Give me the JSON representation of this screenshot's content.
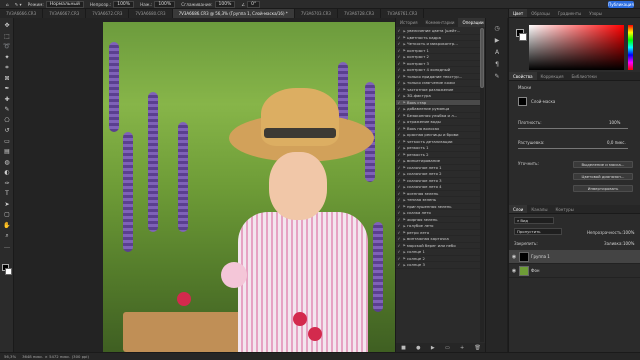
{
  "topbar": {
    "mode_label": "Режим:",
    "mode_value": "Нормальный",
    "opacity_label": "Непрозр.:",
    "opacity_value": "100%",
    "flow_label": "Наж.:",
    "flow_value": "100%",
    "smoothing_label": "Сглаживание:",
    "smoothing_value": "100%",
    "angle_value": "0°",
    "share_label": "Публикация"
  },
  "tabs": [
    {
      "label": "7V3A6666.CR3",
      "active": false
    },
    {
      "label": "7V3A6667.CR3",
      "active": false
    },
    {
      "label": "7V3A6672.CR3",
      "active": false
    },
    {
      "label": "7V3A6680.CR3",
      "active": false
    },
    {
      "label": "7V3A6686.CR3 @ 56,3% (Группа 1, Слой-маска/16) *",
      "active": true
    },
    {
      "label": "7V3A6703.CR3",
      "active": false
    },
    {
      "label": "7V3A6728.CR3",
      "active": false
    },
    {
      "label": "7V3A6761.CR3",
      "active": false
    }
  ],
  "tools": [
    "move-icon",
    "marquee-icon",
    "lasso-icon",
    "quick-select-icon",
    "crop-icon",
    "frame-icon",
    "eyedropper-icon",
    "healing-icon",
    "brush-icon",
    "stamp-icon",
    "history-brush-icon",
    "eraser-icon",
    "gradient-icon",
    "blur-icon",
    "dodge-icon",
    "pen-icon",
    "type-icon",
    "path-select-icon",
    "shape-icon",
    "hand-icon",
    "zoom-icon",
    "more-icon"
  ],
  "ops_panel": {
    "tab_history": "История",
    "tab_comments": "Комментарии",
    "tab_actions": "Операции",
    "items": [
      "увеличение цвета [шейт...",
      "цветность кадра",
      "Четкость и микроконтр...",
      "контраст 1",
      "контраст 2",
      "контраст 3",
      "контраст 4 холодный",
      "только придание текстур...",
      "только смягчение кожи",
      "частотное разложение",
      "3D-фактура",
      "Boxs стар",
      "добавление румянца",
      "Безоконная улыбка и л...",
      "отражение воды",
      "Boxs на волосах",
      "красная ресницы и брови",
      "четкость детализации",
      "резкость 1",
      "резкость 2",
      "виньетирование",
      "сказочное лето 1",
      "сказочное лето 2",
      "сказочное лето 3",
      "сказочное лето 4",
      "осенняя зелень",
      "теплая зелень",
      "приглушенная зелень",
      "сказка лето",
      "жирная зелень",
      "голубое лето",
      "ретро лето",
      "винтажная карточка",
      "морской берег или небо",
      "солнце 1",
      "солнце 2",
      "солнце 3"
    ],
    "selected_index": 11,
    "bottom_icons": [
      "stop-icon",
      "record-icon",
      "play-icon",
      "new-set-icon",
      "new-action-icon",
      "trash-icon"
    ]
  },
  "color_panel": {
    "tab_color": "Цвет",
    "tab_swatches": "Образцы",
    "tab_gradients": "Градиенты",
    "tab_patterns": "Узоры"
  },
  "properties_panel": {
    "tab_properties": "Свойства",
    "tab_adjustments": "Коррекция",
    "tab_libraries": "Библиотеки",
    "masks_label": "Маски",
    "layer_mask_label": "Слой-маска",
    "density_label": "Плотность:",
    "density_value": "100%",
    "feather_label": "Растушевка:",
    "feather_value": "0,0 пикс.",
    "refine_label": "Уточнить:",
    "select_mask_button": "Выделение и маска...",
    "color_range_button": "Цветовой диапазон...",
    "invert_button": "Инвертировать"
  },
  "layers_panel": {
    "tab_layers": "Слои",
    "tab_channels": "Каналы",
    "tab_paths": "Контуры",
    "kind_value": "Вид",
    "blend_value": "Пропустить",
    "opacity_label": "Непрозрачность:",
    "opacity_value": "100%",
    "lock_label": "Закрепить:",
    "fill_label": "Заливка:",
    "fill_value": "100%",
    "layers": [
      {
        "name": "Группа 1",
        "selected": true
      },
      {
        "name": "Фон",
        "selected": false
      }
    ]
  },
  "statusbar": {
    "zoom": "56,3%",
    "doc_size": "3648 пикс. × 5472 пикс. (300 ppi)"
  }
}
